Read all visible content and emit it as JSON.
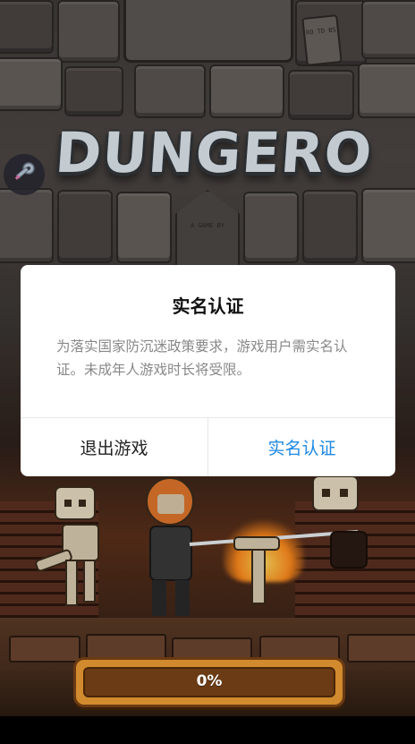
{
  "game": {
    "logo_text": "DUNGERO",
    "plaque_text": "RO TD BS",
    "arch_text": "A GAME BY"
  },
  "dialog": {
    "title": "实名认证",
    "message": "为落实国家防沉迷政策要求，游戏用户需实名认证。未成年人游戏时长将受限。",
    "exit_label": "退出游戏",
    "verify_label": "实名认证"
  },
  "loading": {
    "progress_percent": 0,
    "progress_label": "0%"
  },
  "colors": {
    "verify_accent": "#1e88e5",
    "progress_border": "#d18a2e"
  },
  "icons": {
    "account": "key-icon"
  }
}
